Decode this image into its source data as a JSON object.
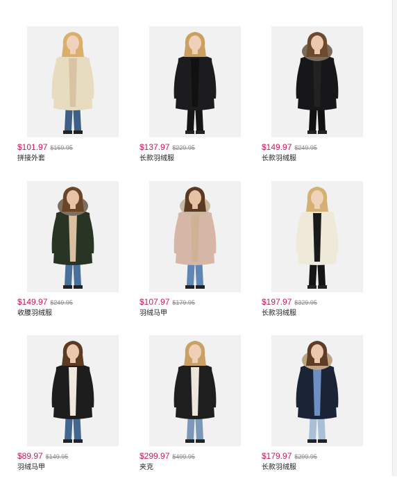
{
  "products": [
    {
      "price": "$101.97",
      "original_price": "$169.95",
      "title": "拼接外套",
      "colors": {
        "jacket": "#e8dcc0",
        "inner": "#d8c3a5",
        "pants": "#3e5f86",
        "hair": "#d8b06a",
        "skin": "#f0d2bc"
      }
    },
    {
      "price": "$137.97",
      "original_price": "$229.95",
      "title": "长款羽绒服",
      "colors": {
        "jacket": "#1c1c1e",
        "inner": "#111111",
        "pants": "#151515",
        "hair": "#c9a060",
        "skin": "#efd0b8"
      }
    },
    {
      "price": "$149.97",
      "original_price": "$249.95",
      "title": "长款羽绒服",
      "colors": {
        "jacket": "#17171a",
        "inner": "#222222",
        "pants": "#111111",
        "hair": "#6b4a2e",
        "skin": "#ecc8ae",
        "fur": "#7a6a5a"
      }
    },
    {
      "price": "$149.97",
      "original_price": "$249.95",
      "title": "收腰羽绒服",
      "colors": {
        "jacket": "#283424",
        "inner": "#d8c0a0",
        "pants": "#4a6f99",
        "hair": "#6a4528",
        "skin": "#e8c3a4",
        "fur": "#7d6f62"
      }
    },
    {
      "price": "$107.97",
      "original_price": "$179.95",
      "title": "羽绒马甲",
      "colors": {
        "jacket": "#d6b6a6",
        "inner": "#cdb393",
        "pants": "#5f86b4",
        "hair": "#5a3a22",
        "skin": "#e6c2a4",
        "fur": "#c9b8a0"
      }
    },
    {
      "price": "$197.97",
      "original_price": "$329.95",
      "title": "长款羽绒服",
      "colors": {
        "jacket": "#efe9da",
        "inner": "#1a1a1a",
        "pants": "#151515",
        "hair": "#d4b072",
        "skin": "#efd2ba"
      }
    },
    {
      "price": "$89.97",
      "original_price": "$149.95",
      "title": "羽绒马甲",
      "colors": {
        "jacket": "#1d1d1d",
        "inner": "#eee8dd",
        "pants": "#44678f",
        "hair": "#5b3b24",
        "skin": "#ecc8ac"
      }
    },
    {
      "price": "$299.97",
      "original_price": "$499.95",
      "title": "夹克",
      "colors": {
        "jacket": "#1e1e1e",
        "inner": "#ece6dc",
        "pants": "#7b98b8",
        "hair": "#c9a065",
        "skin": "#efd0b6"
      }
    },
    {
      "price": "$179.97",
      "original_price": "$299.95",
      "title": "长款羽绒服",
      "colors": {
        "jacket": "#1b2436",
        "inner": "#6d8fc4",
        "pants": "#a9bfd6",
        "hair": "#5e3d26",
        "skin": "#ebc8ac",
        "fur": "#bda47f"
      }
    }
  ]
}
